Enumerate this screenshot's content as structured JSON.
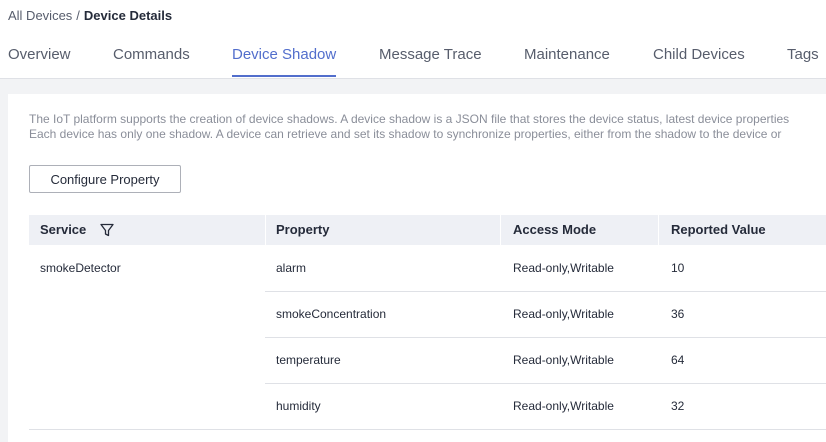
{
  "breadcrumb": {
    "parent": "All Devices",
    "separator": "/",
    "current": "Device Details"
  },
  "tabs": [
    "Overview",
    "Commands",
    "Device Shadow",
    "Message Trace",
    "Maintenance",
    "Child Devices",
    "Tags"
  ],
  "active_tab": "Device Shadow",
  "description": {
    "line1": "The IoT platform supports the creation of device shadows. A device shadow is a JSON file that stores the device status, latest device properties",
    "line2": "Each device has only one shadow. A device can retrieve and set its shadow to synchronize properties, either from the shadow to the device or"
  },
  "configure_button": "Configure Property",
  "table": {
    "columns": [
      "Service",
      "Property",
      "Access Mode",
      "Reported Value"
    ],
    "service": "smokeDetector",
    "rows": [
      {
        "property": "alarm",
        "access_mode": "Read-only,Writable",
        "reported_value": "10"
      },
      {
        "property": "smokeConcentration",
        "access_mode": "Read-only,Writable",
        "reported_value": "36"
      },
      {
        "property": "temperature",
        "access_mode": "Read-only,Writable",
        "reported_value": "64"
      },
      {
        "property": "humidity",
        "access_mode": "Read-only,Writable",
        "reported_value": "32"
      }
    ]
  },
  "colors": {
    "accent": "#526ecc",
    "text": "#252b3a",
    "muted": "#8a8e99",
    "header_bg": "#eef0f5",
    "border": "#dfe1e6",
    "page_bg": "#f2f3f5"
  }
}
